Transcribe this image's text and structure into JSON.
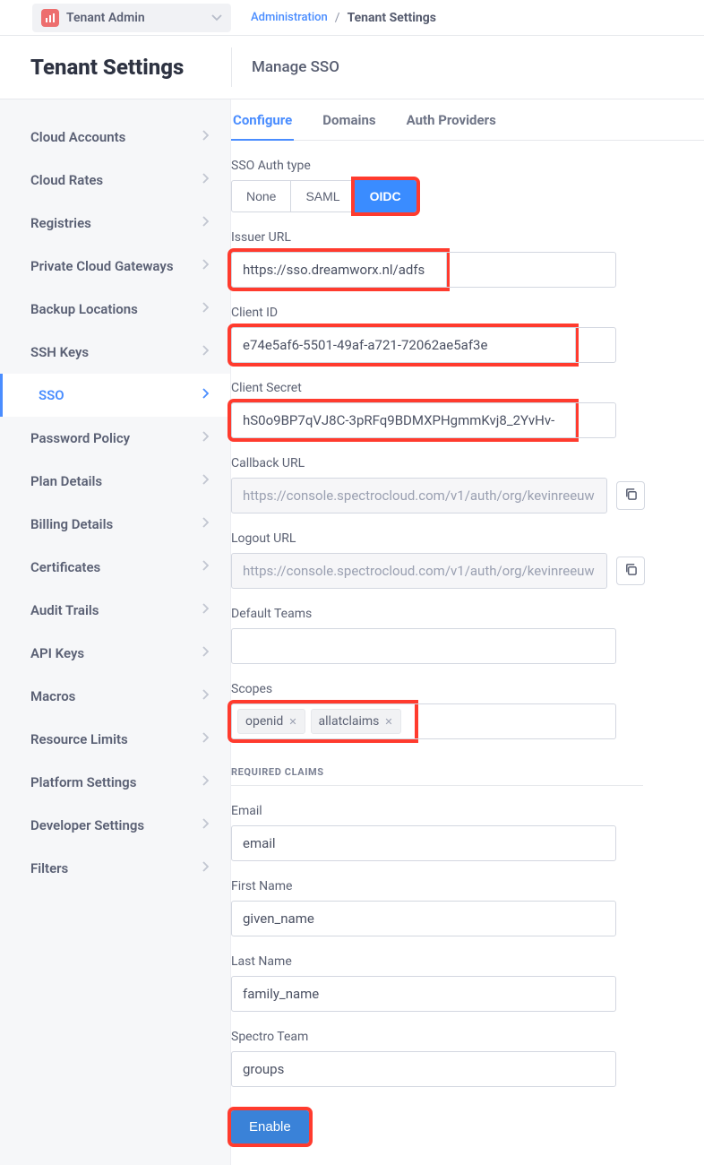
{
  "tenant_selector": {
    "label": "Tenant Admin"
  },
  "breadcrumb": {
    "root": "Administration",
    "current": "Tenant Settings"
  },
  "page_title": "Tenant Settings",
  "section_title": "Manage SSO",
  "tabs": [
    {
      "key": "configure",
      "label": "Configure",
      "active": true
    },
    {
      "key": "domains",
      "label": "Domains",
      "active": false
    },
    {
      "key": "authproviders",
      "label": "Auth Providers",
      "active": false
    }
  ],
  "sidebar": [
    {
      "key": "cloud-accounts",
      "label": "Cloud Accounts"
    },
    {
      "key": "cloud-rates",
      "label": "Cloud Rates"
    },
    {
      "key": "registries",
      "label": "Registries"
    },
    {
      "key": "private-cloud-gateways",
      "label": "Private Cloud Gateways"
    },
    {
      "key": "backup-locations",
      "label": "Backup Locations"
    },
    {
      "key": "ssh-keys",
      "label": "SSH Keys"
    },
    {
      "key": "sso",
      "label": "SSO",
      "active": true
    },
    {
      "key": "password-policy",
      "label": "Password Policy"
    },
    {
      "key": "plan-details",
      "label": "Plan Details"
    },
    {
      "key": "billing-details",
      "label": "Billing Details"
    },
    {
      "key": "certificates",
      "label": "Certificates"
    },
    {
      "key": "audit-trails",
      "label": "Audit Trails"
    },
    {
      "key": "api-keys",
      "label": "API Keys"
    },
    {
      "key": "macros",
      "label": "Macros"
    },
    {
      "key": "resource-limits",
      "label": "Resource Limits"
    },
    {
      "key": "platform-settings",
      "label": "Platform Settings"
    },
    {
      "key": "developer-settings",
      "label": "Developer Settings"
    },
    {
      "key": "filters",
      "label": "Filters"
    }
  ],
  "sso": {
    "label_auth_type": "SSO Auth type",
    "options": {
      "none": "None",
      "saml": "SAML",
      "oidc": "OIDC"
    },
    "labels": {
      "issuer": "Issuer URL",
      "client_id": "Client ID",
      "client_secret": "Client Secret",
      "callback": "Callback URL",
      "logout": "Logout URL",
      "default_teams": "Default Teams",
      "scopes": "Scopes",
      "required_claims": "REQUIRED CLAIMS",
      "email": "Email",
      "first_name": "First Name",
      "last_name": "Last Name",
      "spectro_team": "Spectro Team",
      "enable": "Enable"
    },
    "values": {
      "issuer": "https://sso.dreamworx.nl/adfs",
      "client_id": "e74e5af6-5501-49af-a721-72062ae5af3e",
      "client_secret": "hS0o9BP7qVJ8C-3pRFq9BDMXPHgmmKvj8_2YvHv-",
      "callback": "https://console.spectrocloud.com/v1/auth/org/kevinreeuw",
      "logout": "https://console.spectrocloud.com/v1/auth/org/kevinreeuw",
      "default_teams": "",
      "scopes": [
        "openid",
        "allatclaims"
      ],
      "email": "email",
      "first_name": "given_name",
      "last_name": "family_name",
      "spectro_team": "groups"
    }
  }
}
